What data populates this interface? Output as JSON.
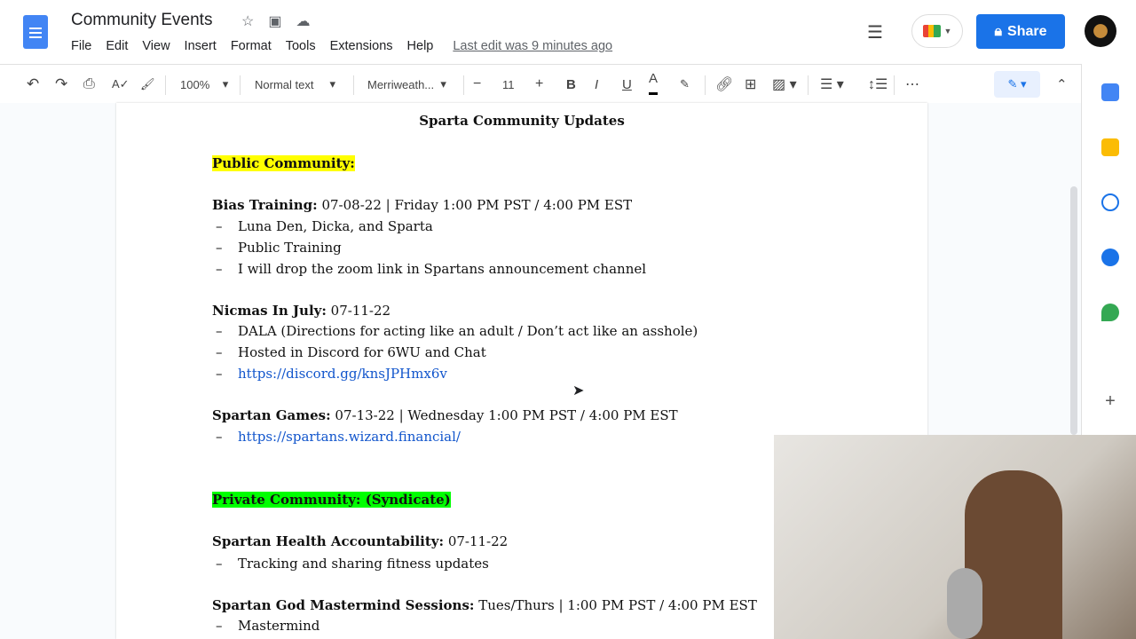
{
  "doc_title": "Community Events",
  "menu": [
    "File",
    "Edit",
    "View",
    "Insert",
    "Format",
    "Tools",
    "Extensions",
    "Help"
  ],
  "last_edit": "Last edit was 9 minutes ago",
  "share_label": "Share",
  "toolbar": {
    "zoom": "100%",
    "style": "Normal text",
    "font": "Merriweath...",
    "font_size": "11"
  },
  "doc": {
    "heading": "Sparta Community Updates",
    "public_heading": "Public Community:",
    "bias_label": "Bias Training:",
    "bias_text": " 07-08-22 | Friday 1:00 PM PST / 4:00 PM EST",
    "bias_items": [
      "Luna Den, Dicka, and Sparta",
      "Public Training",
      "I will drop the zoom link in Spartans announcement channel"
    ],
    "nicmas_label": "Nicmas In July:",
    "nicmas_text": " 07-11-22",
    "nicmas_items": [
      "DALA (Directions for acting like an adult / Don’t act like an asshole)",
      "Hosted in Discord for 6WU and Chat"
    ],
    "nicmas_link": "https://discord.gg/knsJPHmx6v",
    "games_label": "Spartan Games:",
    "games_text": " 07-13-22 | Wednesday 1:00 PM PST / 4:00 PM EST",
    "games_link": "https://spartans.wizard.financial/",
    "private_heading": "Private Community: (Syndicate)",
    "health_label": "Spartan Health Accountability:",
    "health_text": "  07-11-22",
    "health_items": [
      "Tracking and sharing fitness updates"
    ],
    "mastermind_label": "Spartan God Mastermind Sessions:",
    "mastermind_text": " Tues/Thurs | 1:00 PM PST / 4:00 PM EST",
    "mastermind_items": [
      "Mastermind"
    ]
  }
}
